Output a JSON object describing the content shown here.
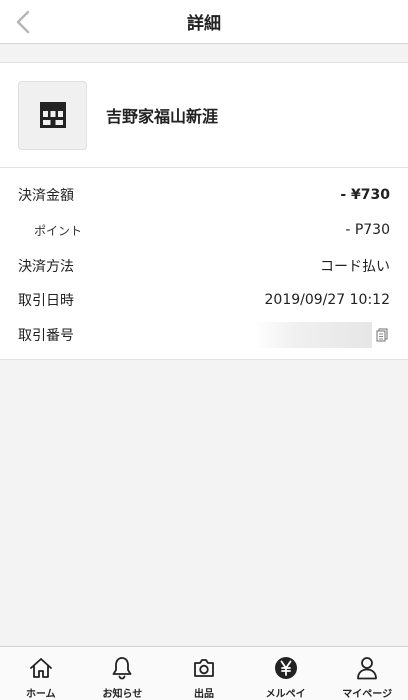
{
  "header": {
    "title": "詳細"
  },
  "store": {
    "name": "吉野家福山新涯"
  },
  "details": {
    "payment_amount_label": "決済金額",
    "payment_amount_value": "- ¥730",
    "points_label": "ポイント",
    "points_value": "- P730",
    "method_label": "決済方法",
    "method_value": "コード払い",
    "date_label": "取引日時",
    "date_value": "2019/09/27 10:12",
    "txn_label": "取引番号"
  },
  "tabbar": {
    "tabs": [
      {
        "label": "ホーム",
        "icon": "home-icon"
      },
      {
        "label": "お知らせ",
        "icon": "bell-icon"
      },
      {
        "label": "出品",
        "icon": "camera-icon"
      },
      {
        "label": "メルペイ",
        "icon": "yen-icon"
      },
      {
        "label": "マイページ",
        "icon": "person-icon"
      }
    ]
  },
  "colors": {
    "background": "#f3f3f3",
    "surface": "#ffffff",
    "text": "#222222",
    "back_chevron": "#b5b5b5"
  }
}
